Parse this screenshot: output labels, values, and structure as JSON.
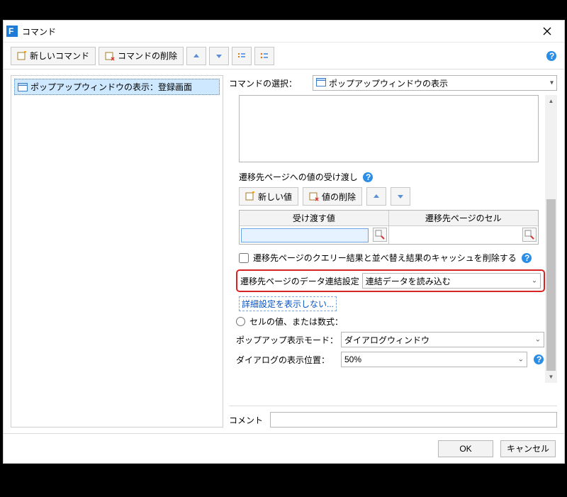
{
  "window": {
    "title": "コマンド"
  },
  "toolbar": {
    "new_label": "新しいコマンド",
    "delete_label": "コマンドの削除"
  },
  "tree": {
    "item0": "ポップアップウィンドウの表示：登録画面"
  },
  "editor": {
    "select_command_label": "コマンドの選択：",
    "selected_command": "ポップアップウィンドウの表示",
    "transfer_section_label": "遷移先ページへの値の受け渡し",
    "new_value_label": "新しい値",
    "delete_value_label": "値の削除",
    "col1": "受け渡す値",
    "col2": "遷移先ページのセル",
    "cache_clear_label": "遷移先ページのクエリー結果と並べ替え結果のキャッシュを削除する",
    "data_bind_setting_label": "遷移先ページのデータ連結設定",
    "data_bind_setting_value": "連結データを読み込む",
    "hide_adv_link": "詳細設定を表示しない...",
    "radio_cell_label": "セルの値、または数式：",
    "popup_mode_label": "ポップアップ表示モード：",
    "popup_mode_value": "ダイアログウィンドウ",
    "dialog_size_label": "ダイアログの表示位置：",
    "dialog_size_value": "50%",
    "comment_label": "コメント"
  },
  "footer": {
    "ok": "OK",
    "cancel": "キャンセル"
  }
}
